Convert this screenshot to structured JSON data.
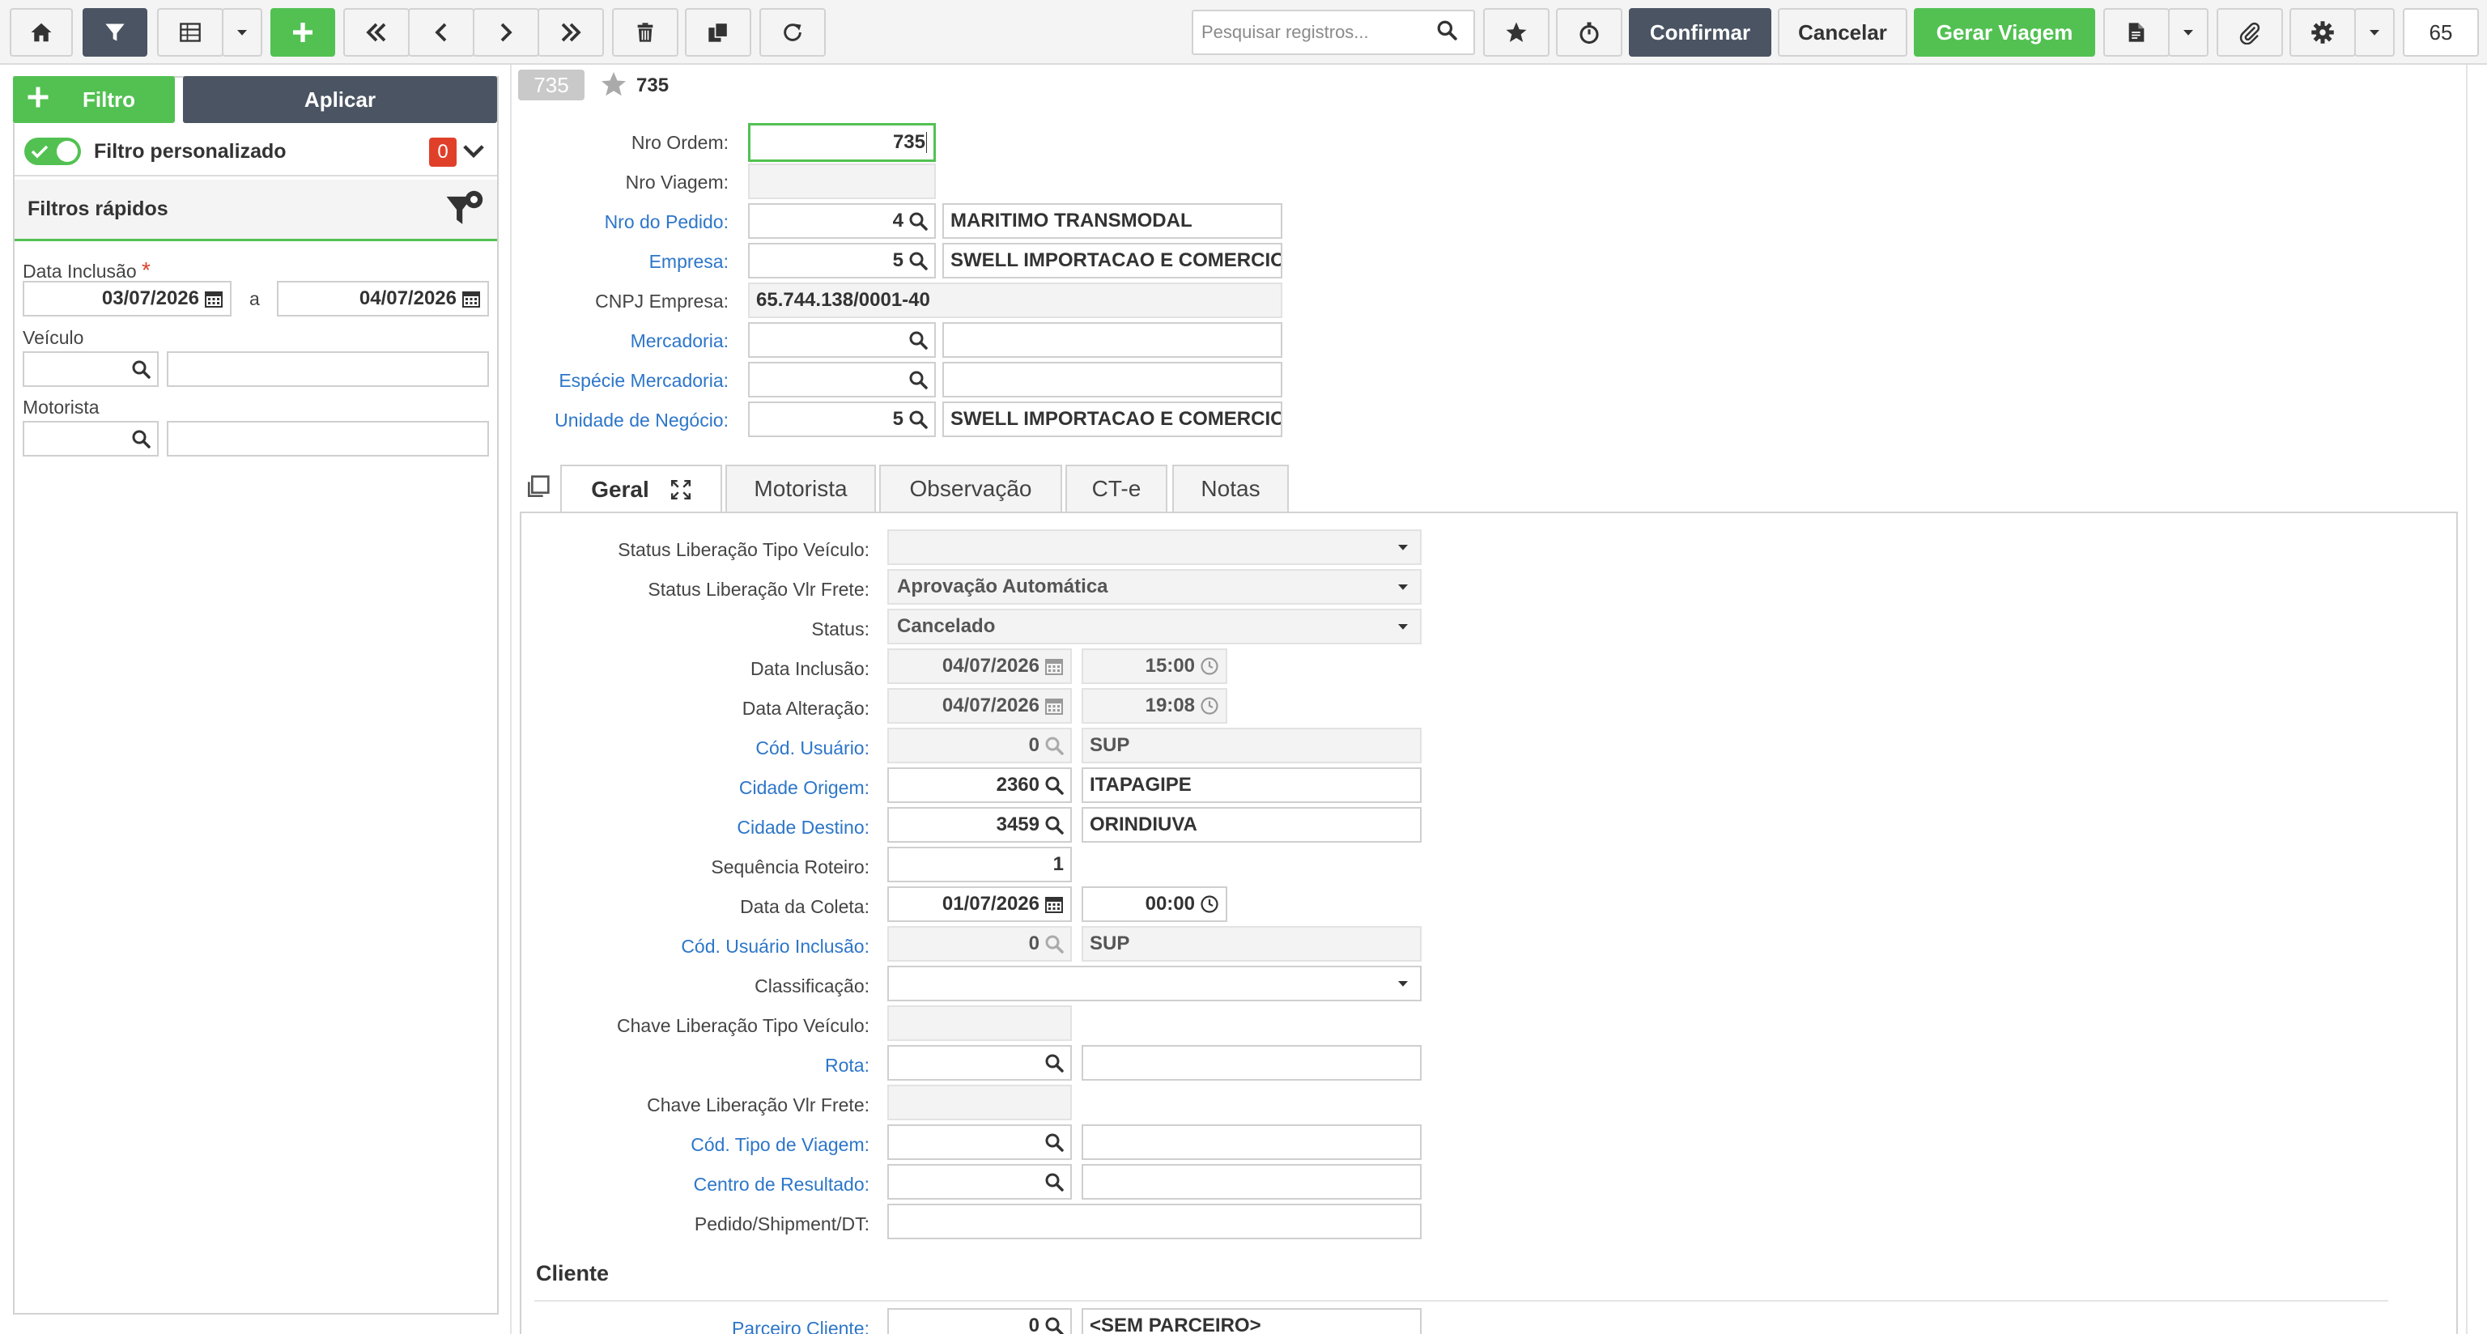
{
  "toolbar": {
    "search_placeholder": "Pesquisar registros...",
    "confirmar": "Confirmar",
    "cancelar": "Cancelar",
    "gerar_viagem": "Gerar Viagem",
    "counter": "65"
  },
  "left": {
    "filtro_button": "Filtro",
    "aplicar_button": "Aplicar",
    "custom_filter_label": "Filtro personalizado",
    "custom_filter_count": "0",
    "quick_filters_title": "Filtros rápidos",
    "data_inclusao_label": "Data Inclusão",
    "required_mark": "*",
    "date_from": "03/07/2026",
    "date_sep": "a",
    "date_to": "04/07/2026",
    "veiculo_label": "Veículo",
    "motorista_label": "Motorista"
  },
  "record": {
    "badge": "735",
    "title": "735"
  },
  "header_fields": {
    "nro_ordem_label": "Nro Ordem:",
    "nro_ordem_value": "735",
    "nro_viagem_label": "Nro Viagem:",
    "nro_pedido_label": "Nro do Pedido:",
    "nro_pedido_code": "4",
    "nro_pedido_desc": "MARITIMO TRANSMODAL",
    "empresa_label": "Empresa:",
    "empresa_code": "5",
    "empresa_desc": "SWELL IMPORTACAO E COMERCIO",
    "cnpj_label": "CNPJ Empresa:",
    "cnpj_value": "65.744.138/0001-40",
    "mercadoria_label": "Mercadoria:",
    "especie_label": "Espécie Mercadoria:",
    "unidade_label": "Unidade de Negócio:",
    "unidade_code": "5",
    "unidade_desc": "SWELL IMPORTACAO E COMERCIO"
  },
  "tabs": [
    "Geral",
    "Motorista",
    "Observação",
    "CT-e",
    "Notas"
  ],
  "geral": {
    "status_tipo_veiculo_label": "Status Liberação Tipo Veículo:",
    "status_vlr_frete_label": "Status Liberação Vlr Frete:",
    "status_vlr_frete_value": "Aprovação Automática",
    "status_label": "Status:",
    "status_value": "Cancelado",
    "data_inclusao_label": "Data Inclusão:",
    "data_inclusao_date": "04/07/2026",
    "data_inclusao_time": "15:00",
    "data_alteracao_label": "Data Alteração:",
    "data_alteracao_date": "04/07/2026",
    "data_alteracao_time": "19:08",
    "cod_usuario_label": "Cód. Usuário:",
    "cod_usuario_code": "0",
    "cod_usuario_name": "SUP",
    "cidade_origem_label": "Cidade Origem:",
    "cidade_origem_code": "2360",
    "cidade_origem_name": "ITAPAGIPE",
    "cidade_destino_label": "Cidade Destino:",
    "cidade_destino_code": "3459",
    "cidade_destino_name": "ORINDIUVA",
    "sequencia_label": "Sequência Roteiro:",
    "sequencia_value": "1",
    "data_coleta_label": "Data da Coleta:",
    "data_coleta_date": "01/07/2026",
    "data_coleta_time": "00:00",
    "cod_usuario_inc_label": "Cód. Usuário Inclusão:",
    "cod_usuario_inc_code": "0",
    "cod_usuario_inc_name": "SUP",
    "classificacao_label": "Classificação:",
    "chave_tipo_veiculo_label": "Chave Liberação Tipo Veículo:",
    "rota_label": "Rota:",
    "chave_vlr_frete_label": "Chave Liberação Vlr Frete:",
    "cod_tipo_viagem_label": "Cód. Tipo de Viagem:",
    "centro_resultado_label": "Centro de Resultado:",
    "pedido_shipment_label": "Pedido/Shipment/DT:",
    "cliente_section": "Cliente",
    "parceiro_cliente_label": "Parceiro Cliente:",
    "parceiro_cliente_code": "0",
    "parceiro_cliente_name": "<SEM PARCEIRO>"
  },
  "colors": {
    "green": "#52c152",
    "dark": "#4a5462",
    "link": "#2d76c9",
    "badge_red": "#e0402a"
  }
}
